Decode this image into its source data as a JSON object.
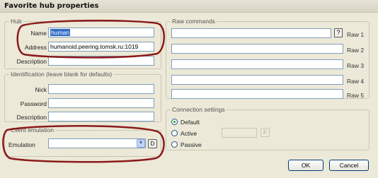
{
  "window": {
    "title": "Favorite hub properties"
  },
  "hub": {
    "legend": "Hub",
    "name_label": "Name",
    "name_value": "human",
    "address_label": "Address",
    "address_value": "humanoid.peering.tomsk.ru:1019",
    "description_label": "Description",
    "description_value": ""
  },
  "identification": {
    "legend": "Identification (leave blank for defaults)",
    "nick_label": "Nick",
    "nick_value": "",
    "password_label": "Password",
    "password_value": "",
    "description_label": "Description",
    "description_value": ""
  },
  "client_emulation": {
    "legend": "Client emulation",
    "emulation_label": "Emulation",
    "emulation_value": "",
    "small_button": "D"
  },
  "raw_commands": {
    "legend": "Raw commands",
    "help_button": "?",
    "items": [
      "Raw 1",
      "Raw 2",
      "Raw 3",
      "Raw 4",
      "Raw 5"
    ]
  },
  "connection": {
    "legend": "Connection settings",
    "default_label": "Default",
    "active_label": "Active",
    "passive_label": "Passive",
    "selected": "Default",
    "ip_value": "",
    "small_button": "F"
  },
  "buttons": {
    "ok": "OK",
    "cancel": "Cancel"
  },
  "colors": {
    "annotation_red": "#8b1a1a",
    "field_border": "#7f9db9"
  }
}
